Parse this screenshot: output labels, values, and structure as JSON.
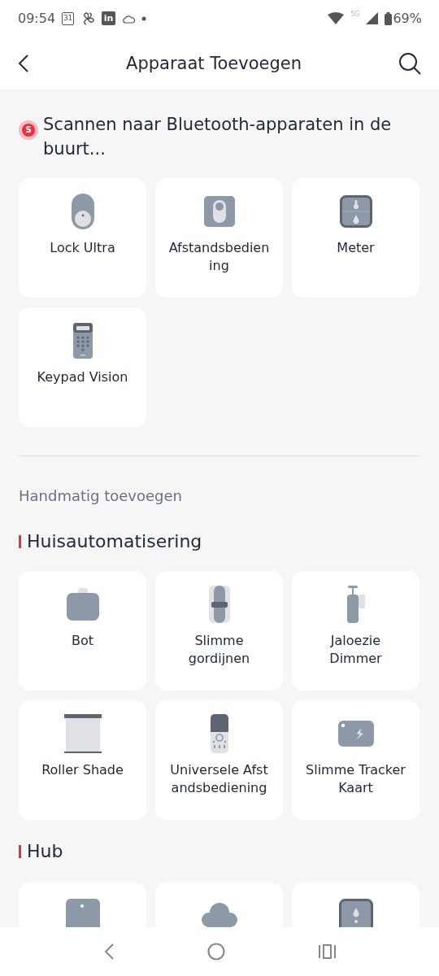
{
  "status_bar": {
    "time": "09:54",
    "calendar_day": "31",
    "linkedin": "in",
    "network": "5G",
    "battery": "69%"
  },
  "header": {
    "title": "Apparaat Toevoegen"
  },
  "scan": {
    "badge": "S",
    "text": "Scannen naar Bluetooth-apparaten in de buurt..."
  },
  "nearby_devices": [
    {
      "kind": "lock",
      "label": "Lock Ultra"
    },
    {
      "kind": "remote",
      "label": "Afstandsbedien\ning"
    },
    {
      "kind": "meter",
      "label": "Meter"
    },
    {
      "kind": "keypad",
      "label": "Keypad Vision"
    }
  ],
  "manual": {
    "title": "Handmatig toevoegen",
    "categories": [
      {
        "title": "Huisautomatisering",
        "devices": [
          {
            "kind": "bot",
            "label": "Bot"
          },
          {
            "kind": "curtain",
            "label": "Slimme\ngordijnen"
          },
          {
            "kind": "blind",
            "label": "Jaloezie\nDimmer"
          },
          {
            "kind": "roller",
            "label": "Roller Shade"
          },
          {
            "kind": "universal-remote",
            "label": "Universele Afst\nandsbediening"
          },
          {
            "kind": "tracker",
            "label": "Slimme Tracker\nKaart"
          }
        ]
      },
      {
        "title": "Hub",
        "devices": [
          {
            "kind": "hub"
          },
          {
            "kind": "cloud-hub"
          },
          {
            "kind": "hub-display"
          }
        ]
      }
    ]
  }
}
